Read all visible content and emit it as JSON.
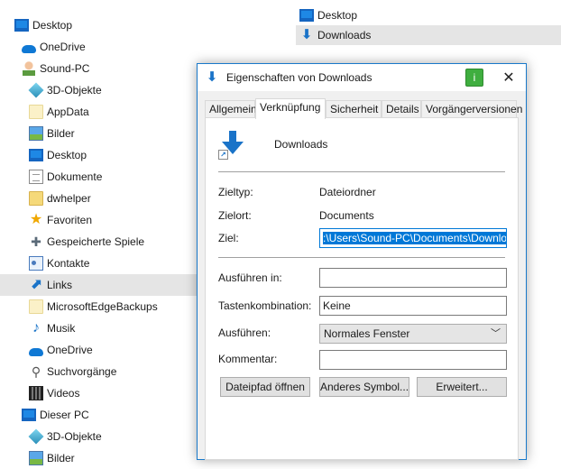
{
  "tree": {
    "items": [
      {
        "label": "Desktop",
        "icon": "desktop-icon"
      },
      {
        "label": "OneDrive",
        "icon": "onedrive-icon"
      },
      {
        "label": "Sound-PC",
        "icon": "user-icon"
      },
      {
        "label": "3D-Objekte",
        "icon": "cube-icon"
      },
      {
        "label": "AppData",
        "icon": "folder-icon"
      },
      {
        "label": "Bilder",
        "icon": "pictures-icon"
      },
      {
        "label": "Desktop",
        "icon": "desktop-icon"
      },
      {
        "label": "Dokumente",
        "icon": "document-icon"
      },
      {
        "label": "dwhelper",
        "icon": "folder-icon"
      },
      {
        "label": "Favoriten",
        "icon": "star-icon"
      },
      {
        "label": "Gespeicherte Spiele",
        "icon": "gamepad-icon"
      },
      {
        "label": "Kontakte",
        "icon": "contacts-icon"
      },
      {
        "label": "Links",
        "icon": "link-arrow-icon"
      },
      {
        "label": "MicrosoftEdgeBackups",
        "icon": "folder-icon"
      },
      {
        "label": "Musik",
        "icon": "music-note-icon"
      },
      {
        "label": "OneDrive",
        "icon": "onedrive-icon"
      },
      {
        "label": "Suchvorgänge",
        "icon": "search-icon"
      },
      {
        "label": "Videos",
        "icon": "video-icon"
      },
      {
        "label": "Dieser PC",
        "icon": "desktop-icon"
      },
      {
        "label": "3D-Objekte",
        "icon": "cube-icon"
      },
      {
        "label": "Bilder",
        "icon": "pictures-icon"
      }
    ]
  },
  "right_list": {
    "items": [
      {
        "label": "Desktop",
        "icon": "desktop-shortcut-icon"
      },
      {
        "label": "Downloads",
        "icon": "downloads-shortcut-icon"
      }
    ]
  },
  "dialog": {
    "title": "Eigenschaften von Downloads",
    "help_glyph": "i",
    "close_glyph": "✕",
    "tabs": [
      "Allgemein",
      "Verknüpfung",
      "Sicherheit",
      "Details",
      "Vorgängerversionen"
    ],
    "file_name": "Downloads",
    "target_type_label": "Zieltyp:",
    "target_type_value": "Dateiordner",
    "target_location_label": "Zielort:",
    "target_location_value": "Documents",
    "target_label": "Ziel:",
    "target_value": ":\\Users\\Sound-PC\\Documents\\Downloads",
    "start_in_label": "Ausführen in:",
    "start_in_value": "",
    "shortcut_key_label": "Tastenkombination:",
    "shortcut_key_value": "Keine",
    "run_label": "Ausführen:",
    "run_value": "Normales Fenster",
    "comment_label": "Kommentar:",
    "comment_value": "",
    "btn_open_location": "Dateipfad öffnen",
    "btn_change_icon": "Anderes Symbol...",
    "btn_advanced": "Erweitert..."
  }
}
